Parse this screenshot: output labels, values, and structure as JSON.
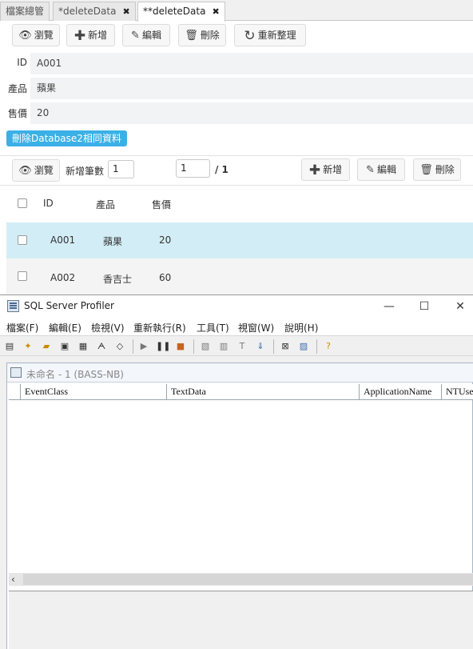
{
  "tabs": [
    {
      "label": "檔案總管"
    },
    {
      "label": "*deleteData",
      "close": "✖"
    },
    {
      "label": "**deleteData",
      "close": "✖"
    }
  ],
  "toolbar": {
    "browse": "瀏覽",
    "add": "新增",
    "edit": "編輯",
    "delete": "刪除",
    "reorganize": "重新整理"
  },
  "form": {
    "id_label": "ID",
    "id_value": "A001",
    "product_label": "產品",
    "product_value": "蘋果",
    "price_label": "售價",
    "price_value": "20"
  },
  "delete_db2_button": "刪除Database2相同資料",
  "grid_toolbar": {
    "browse": "瀏覽",
    "add_count_label": "新增筆數",
    "add_count_value": "1",
    "page_value": "1",
    "page_total": "/ 1",
    "add": "新增",
    "edit": "編輯",
    "delete": "刪除"
  },
  "grid": {
    "headers": [
      "ID",
      "產品",
      "售價"
    ],
    "rows": [
      {
        "id": "A001",
        "product": "蘋果",
        "price": "20"
      },
      {
        "id": "A002",
        "product": "香吉士",
        "price": "60"
      }
    ]
  },
  "profiler": {
    "title": "SQL Server Profiler",
    "menu": [
      "檔案(F)",
      "編輯(E)",
      "檢視(V)",
      "重新執行(R)",
      "工具(T)",
      "視窗(W)",
      "說明(H)"
    ],
    "doc_title": "未命名 - 1 (BASS-NB)",
    "columns": [
      "EventClass",
      "TextData",
      "ApplicationName",
      "NTUser"
    ],
    "scroll_left": "‹"
  },
  "colors": {
    "accent": "#3ab0e6",
    "selected_row": "#d3edf6"
  }
}
